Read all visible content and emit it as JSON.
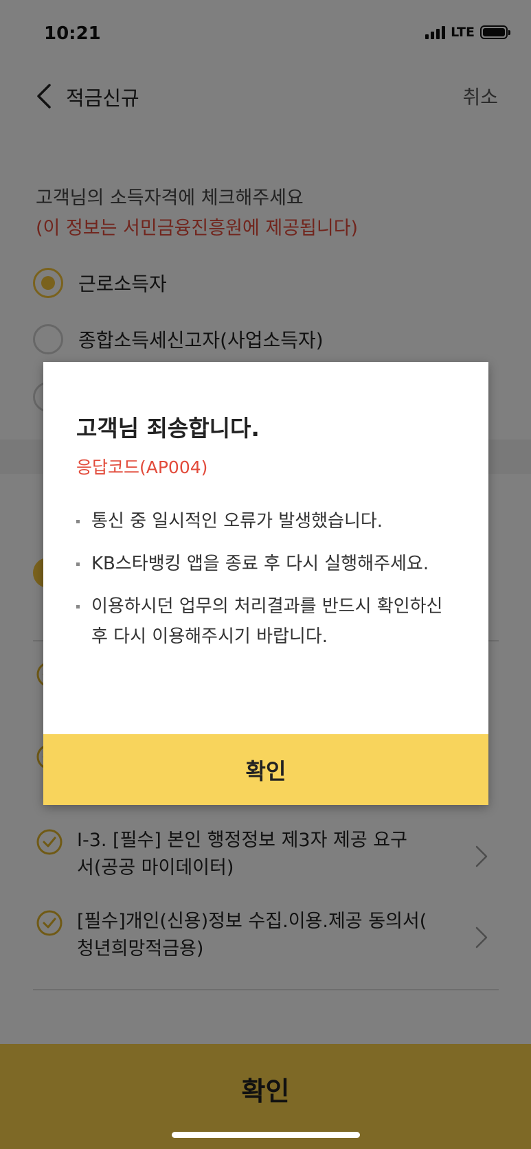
{
  "status_bar": {
    "time": "10:21",
    "network": "LTE"
  },
  "nav": {
    "title": "적금신규",
    "cancel_label": "취소"
  },
  "form": {
    "instruction": "고객님의 소득자격에 체크해주세요",
    "notice": "(이 정보는 서민금융진흥원에 제공됩니다)",
    "options": [
      {
        "label": "근로소득자",
        "selected": true
      },
      {
        "label": "종합소득세신고자(사업소득자)",
        "selected": false
      }
    ]
  },
  "agreements": [
    {
      "lines": [
        "Ⅰ-3. [필수] 본인 행정정보 제3자 제공 요구",
        "서(공공 마이데이터)"
      ]
    },
    {
      "lines": [
        "[필수]개인(신용)정보 수집.이용.제공 동의서(",
        "청년희망적금용)"
      ]
    }
  ],
  "bottom_button": {
    "label": "확인"
  },
  "dialog": {
    "title": "고객님 죄송합니다.",
    "code": "응답코드(AP004)",
    "messages": [
      "통신 중 일시적인 오류가 발생했습니다.",
      "KB스타뱅킹 앱을 종료 후 다시 실행해주세요.",
      "이용하시던 업무의 처리결과를 반드시 확인하신 후 다시 이용해주시기 바랍니다."
    ],
    "confirm_label": "확인"
  },
  "colors": {
    "accent": "#fcd34d",
    "notice_red": "#e24b3b"
  }
}
